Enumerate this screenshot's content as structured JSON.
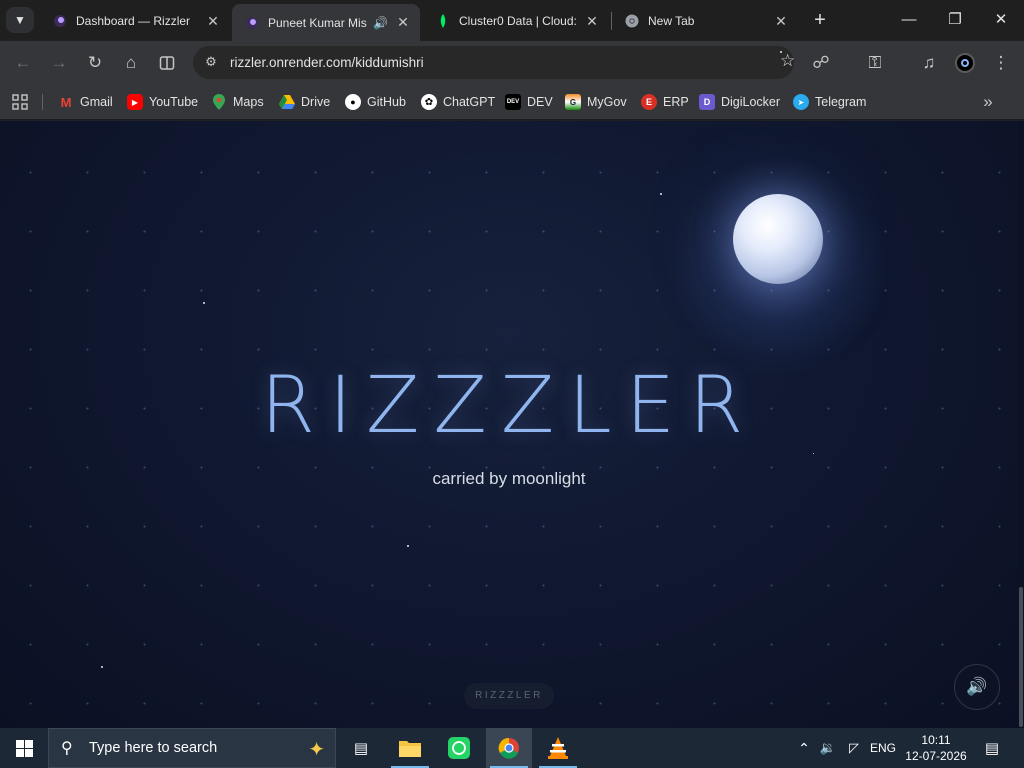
{
  "browser": {
    "tabs": [
      {
        "title": "Dashboard — Rizzler",
        "active": false
      },
      {
        "title": "Puneet Kumar Mis",
        "active": true,
        "audio": true
      },
      {
        "title": "Cluster0 Data | Cloud: ",
        "active": false
      },
      {
        "title": "New Tab",
        "active": false
      }
    ],
    "address": {
      "url": "rizzler.onrender.com/kiddumishri"
    },
    "bookmarks": [
      {
        "label": "Gmail",
        "color": "#ea4335",
        "glyph": "M"
      },
      {
        "label": "YouTube",
        "color": "#ff0000",
        "glyph": "▶"
      },
      {
        "label": "Maps",
        "color": "#34a853",
        "glyph": "⚲"
      },
      {
        "label": "Drive",
        "color": "#fbbc04",
        "glyph": "▲"
      },
      {
        "label": "GitHub",
        "color": "#ffffff",
        "glyph": "●"
      },
      {
        "label": "ChatGPT",
        "color": "#ffffff",
        "glyph": "✿"
      },
      {
        "label": "DEV",
        "color": "#000000",
        "glyph": "DEV"
      },
      {
        "label": "MyGov",
        "color": "#f28c28",
        "glyph": "G"
      },
      {
        "label": "ERP",
        "color": "#d93025",
        "glyph": "E"
      },
      {
        "label": "DigiLocker",
        "color": "#6a5acd",
        "glyph": "D"
      },
      {
        "label": "Telegram",
        "color": "#2aabee",
        "glyph": "➤"
      }
    ]
  },
  "page": {
    "title": "RIZZZLER",
    "subtitle": "carried by moonlight",
    "footer_pill": "RIZZZLER",
    "colors": {
      "title": "#8fb4ee",
      "background": "#0f172d",
      "moon": "#dfe7fa"
    }
  },
  "taskbar": {
    "search_placeholder": "Type here to search",
    "language": "ENG",
    "time": "10:11",
    "date": "12-07-2026"
  }
}
